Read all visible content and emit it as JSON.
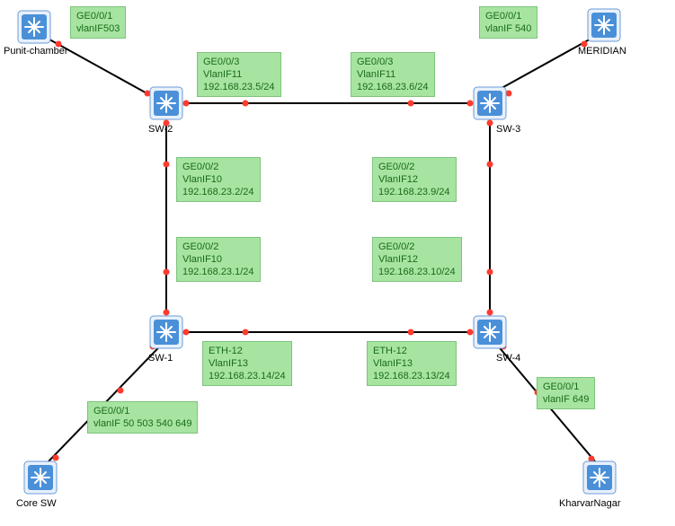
{
  "devices": {
    "punit": {
      "label": "Punit-chamber"
    },
    "meridian": {
      "label": "MERIDIAN"
    },
    "coresw": {
      "label": "Core SW"
    },
    "kharvar": {
      "label": "KharvarNagar"
    },
    "sw1": {
      "label": "SW-1"
    },
    "sw2": {
      "label": "SW-2"
    },
    "sw3": {
      "label": "SW-3"
    },
    "sw4": {
      "label": "SW-4"
    }
  },
  "labels": {
    "punit_ge": {
      "l1": "GE0/0/1",
      "l2": "vlanIF503"
    },
    "mer_ge": {
      "l1": "GE0/0/1",
      "l2": "vlanIF 540"
    },
    "sw2_top": {
      "l1": "GE0/0/3",
      "l2": "VlanIF11",
      "l3": "192.168.23.5/24"
    },
    "sw3_top": {
      "l1": "GE0/0/3",
      "l2": "VlanIF11",
      "l3": "192.168.23.6/24"
    },
    "sw2_down": {
      "l1": "GE0/0/2",
      "l2": "VlanIF10",
      "l3": "192.168.23.2/24"
    },
    "sw3_down": {
      "l1": "GE0/0/2",
      "l2": "VlanIF12",
      "l3": "192.168.23.9/24"
    },
    "sw1_up": {
      "l1": "GE0/0/2",
      "l2": "VlanIF10",
      "l3": "192.168.23.1/24"
    },
    "sw4_up": {
      "l1": "GE0/0/2",
      "l2": "VlanIF12",
      "l3": "192.168.23.10/24"
    },
    "sw1_right": {
      "l1": "ETH-12",
      "l2": "VlanIF13",
      "l3": "192.168.23.14/24"
    },
    "sw4_left": {
      "l1": "ETH-12",
      "l2": "VlanIF13",
      "l3": "192.168.23.13/24"
    },
    "core_ge": {
      "l1": "GE0/0/1",
      "l2": "vlanIF 50 503 540 649"
    },
    "khar_ge": {
      "l1": "GE0/0/1",
      "l2": "vlanIF 649"
    }
  },
  "chart_data": {
    "type": "network-topology",
    "nodes": [
      {
        "id": "Punit-chamber",
        "type": "switch"
      },
      {
        "id": "MERIDIAN",
        "type": "switch"
      },
      {
        "id": "Core SW",
        "type": "switch"
      },
      {
        "id": "KharvarNagar",
        "type": "switch"
      },
      {
        "id": "SW-1",
        "type": "switch"
      },
      {
        "id": "SW-2",
        "type": "switch"
      },
      {
        "id": "SW-3",
        "type": "switch"
      },
      {
        "id": "SW-4",
        "type": "switch"
      }
    ],
    "links": [
      {
        "a": "Punit-chamber",
        "b": "SW-2",
        "a_port": "GE0/0/1",
        "a_vlanif": "503"
      },
      {
        "a": "MERIDIAN",
        "b": "SW-3",
        "a_port": "GE0/0/1",
        "a_vlanif": "540"
      },
      {
        "a": "SW-2",
        "b": "SW-3",
        "a_port": "GE0/0/3",
        "a_vlanif": "VlanIF11",
        "a_ip": "192.168.23.5/24",
        "b_port": "GE0/0/3",
        "b_vlanif": "VlanIF11",
        "b_ip": "192.168.23.6/24"
      },
      {
        "a": "SW-2",
        "b": "SW-1",
        "a_port": "GE0/0/2",
        "a_vlanif": "VlanIF10",
        "a_ip": "192.168.23.2/24",
        "b_port": "GE0/0/2",
        "b_vlanif": "VlanIF10",
        "b_ip": "192.168.23.1/24"
      },
      {
        "a": "SW-3",
        "b": "SW-4",
        "a_port": "GE0/0/2",
        "a_vlanif": "VlanIF12",
        "a_ip": "192.168.23.9/24",
        "b_port": "GE0/0/2",
        "b_vlanif": "VlanIF12",
        "b_ip": "192.168.23.10/24"
      },
      {
        "a": "SW-1",
        "b": "SW-4",
        "a_port": "ETH-12",
        "a_vlanif": "VlanIF13",
        "a_ip": "192.168.23.14/24",
        "b_port": "ETH-12",
        "b_vlanif": "VlanIF13",
        "b_ip": "192.168.23.13/24"
      },
      {
        "a": "SW-1",
        "b": "Core SW",
        "b_port": "GE0/0/1",
        "b_vlanif": "50 503 540 649"
      },
      {
        "a": "SW-4",
        "b": "KharvarNagar",
        "b_port": "GE0/0/1",
        "b_vlanif": "649"
      }
    ]
  }
}
